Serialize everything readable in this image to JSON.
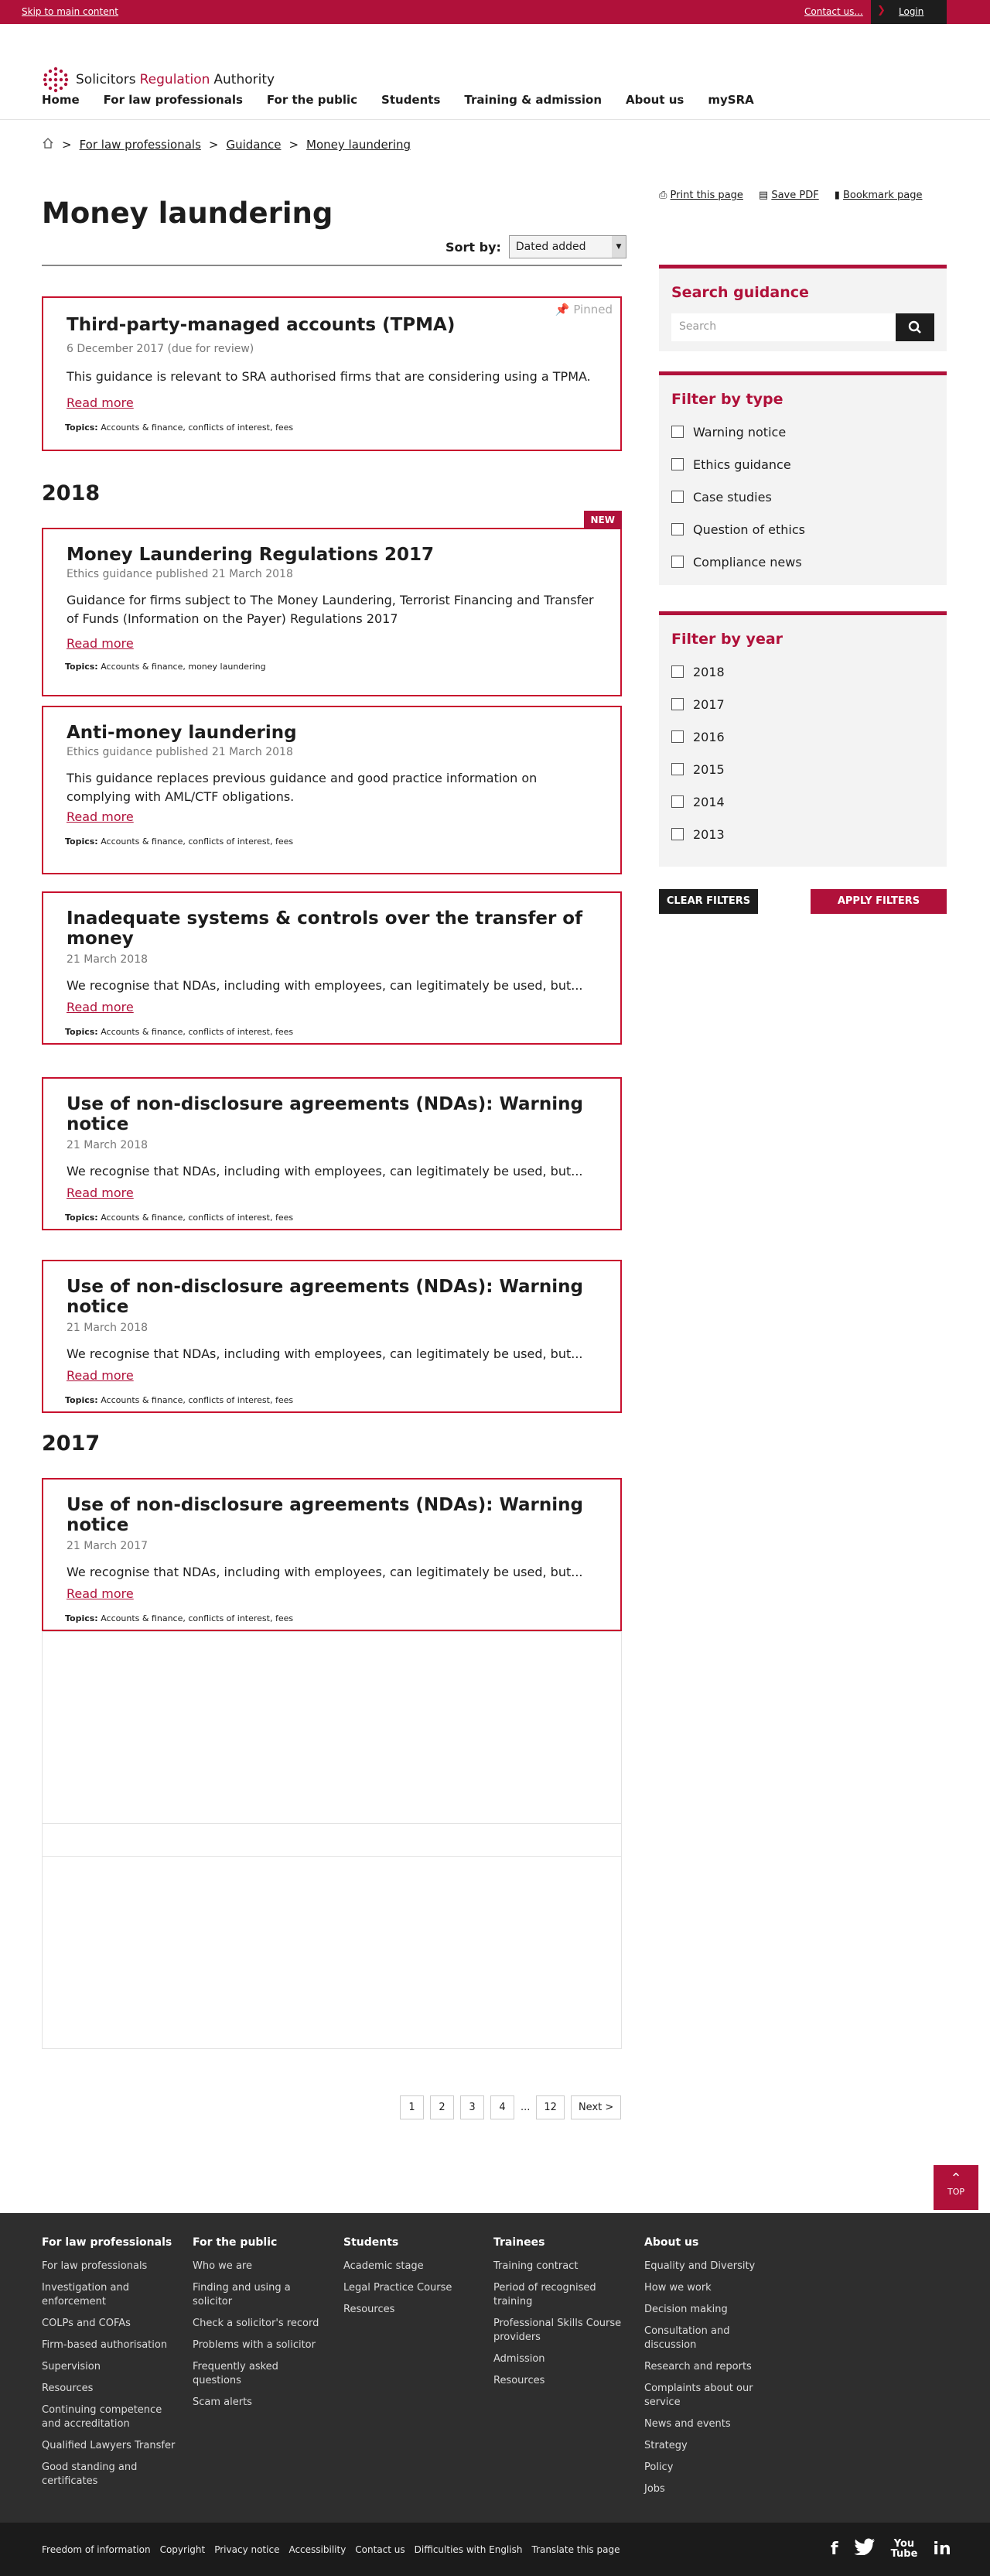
{
  "topbar": {
    "skip": "Skip to main content",
    "contact": "Contact us...",
    "login": "Login"
  },
  "logo": {
    "part1": "Solicitors",
    "part2": "Regulation",
    "part3": "Authority"
  },
  "nav": [
    "Home",
    "For law professionals",
    "For the public",
    "Students",
    "Training & admission",
    "About us",
    "mySRA"
  ],
  "breadcrumb": [
    "For law professionals",
    "Guidance",
    "Money laundering"
  ],
  "page_title": "Money laundering",
  "tools": {
    "print": "Print this page",
    "pdf": "Save PDF",
    "bookmark": "Bookmark page"
  },
  "sort": {
    "label": "Sort by:",
    "value": "Dated added"
  },
  "pinned_label": "Pinned",
  "new_label": "NEW",
  "read_more": "Read more",
  "topics_label": "Topics:",
  "cards": [
    {
      "title": "Third-party-managed accounts (TPMA)",
      "meta": "6 December 2017 (due for review)",
      "summary": "This guidance is relevant to SRA authorised firms that are considering using a TPMA.",
      "topics": "Accounts & finance, conflicts of interest, fees"
    },
    {
      "title": "Money Laundering Regulations 2017",
      "meta": "Ethics guidance published 21 March 2018",
      "summary": "Guidance for firms subject to The Money Laundering, Terrorist Financing and Transfer of Funds (Information on the Payer) Regulations 2017",
      "topics": "Accounts & finance, money laundering"
    },
    {
      "title": "Anti-money laundering",
      "meta": "Ethics guidance published 21 March 2018",
      "summary": "This guidance replaces previous guidance and good practice information on complying with AML/CTF obligations.",
      "topics": "Accounts & finance, conflicts of interest, fees"
    },
    {
      "title": "Inadequate systems & controls over the transfer of money",
      "meta": "21 March 2018",
      "summary": "We recognise that NDAs, including with employees, can legitimately be used, but...",
      "topics": "Accounts & finance, conflicts of interest, fees"
    },
    {
      "title": "Use of non-disclosure agreements (NDAs): Warning notice",
      "meta": "21 March 2018",
      "summary": "We recognise that NDAs, including with employees, can legitimately be used, but...",
      "topics": "Accounts & finance, conflicts of interest, fees"
    },
    {
      "title": "Use of non-disclosure agreements (NDAs): Warning notice",
      "meta": "21 March 2018",
      "summary": "We recognise that NDAs, including with employees, can legitimately be used, but...",
      "topics": "Accounts & finance, conflicts of interest, fees"
    },
    {
      "title": "Use of non-disclosure agreements (NDAs): Warning notice",
      "meta": "21 March 2017",
      "summary": "We recognise that NDAs, including with employees, can legitimately be used, but...",
      "topics": "Accounts & finance, conflicts of interest, fees"
    }
  ],
  "years": [
    "2018",
    "2017"
  ],
  "search": {
    "title": "Search guidance",
    "placeholder": "Search"
  },
  "filter_type": {
    "title": "Filter by type",
    "options": [
      "Warning notice",
      "Ethics guidance",
      "Case studies",
      "Question of ethics",
      "Compliance news"
    ]
  },
  "filter_year": {
    "title": "Filter by year",
    "options": [
      "2018",
      "2017",
      "2016",
      "2015",
      "2014",
      "2013"
    ]
  },
  "buttons": {
    "clear": "CLEAR FILTERS",
    "apply": "APPLY FILTERS"
  },
  "pagination": {
    "pages": [
      "1",
      "2",
      "3",
      "4"
    ],
    "ellipsis": "...",
    "last": "12",
    "next": "Next >"
  },
  "to_top": "TOP",
  "footer": {
    "columns": [
      {
        "title": "For law professionals",
        "links": [
          "For law professionals",
          "Investigation and enforcement",
          "COLPs and COFAs",
          "Firm-based authorisation",
          "Supervision",
          "Resources",
          "Continuing competence and accreditation",
          "Qualified Lawyers Transfer",
          "Good standing and certificates"
        ]
      },
      {
        "title": "For the public",
        "links": [
          "Who we are",
          "Finding and using a solicitor",
          "Check a solicitor's record",
          "Problems with a solicitor",
          "Frequently asked questions",
          "Scam alerts"
        ]
      },
      {
        "title": "Students",
        "links": [
          "Academic stage",
          "Legal Practice Course",
          "Resources"
        ]
      },
      {
        "title": "Trainees",
        "links": [
          "Training contract",
          "Period of recognised training",
          "Professional Skills Course providers",
          "Admission",
          "Resources"
        ]
      },
      {
        "title": "About us",
        "links": [
          "Equality and Diversity",
          "How we work",
          "Decision making",
          "Consultation and discussion",
          "Research and reports",
          "Complaints about our service",
          "News and events",
          "Strategy",
          "Policy",
          "Jobs"
        ]
      }
    ],
    "bottom_links": [
      "Freedom of information",
      "Copyright",
      "Privacy notice",
      "Accessibility",
      "Contact us",
      "Difficulties with English",
      "Translate this page"
    ],
    "social": [
      "facebook-icon",
      "twitter-icon",
      "youtube-icon",
      "linkedin-icon"
    ]
  }
}
